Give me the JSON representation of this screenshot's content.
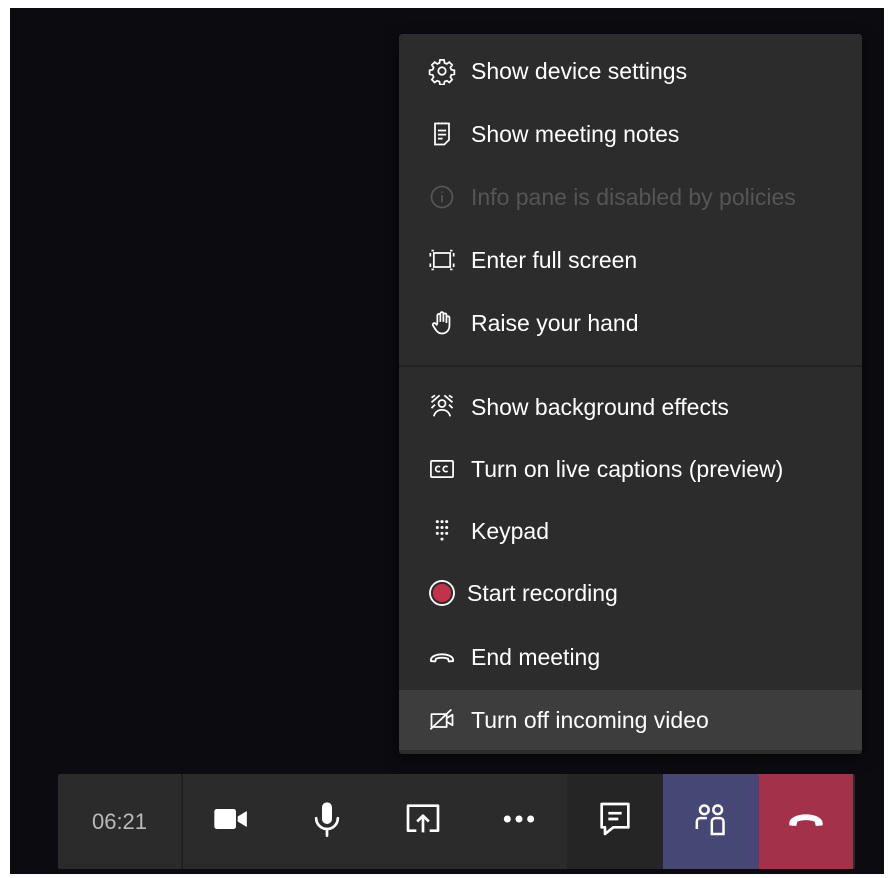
{
  "menu": {
    "items": [
      {
        "label": "Show device settings",
        "icon": "gear-icon"
      },
      {
        "label": "Show meeting notes",
        "icon": "notes-icon"
      },
      {
        "label": "Info pane is disabled by policies",
        "icon": "info-icon",
        "disabled": true
      },
      {
        "label": "Enter full screen",
        "icon": "fullscreen-icon"
      },
      {
        "label": "Raise your hand",
        "icon": "hand-icon"
      },
      {
        "label": "Show background effects",
        "icon": "background-effects-icon"
      },
      {
        "label": "Turn on live captions (preview)",
        "icon": "captions-icon"
      },
      {
        "label": "Keypad",
        "icon": "keypad-icon"
      },
      {
        "label": "Start recording",
        "icon": "record-icon"
      },
      {
        "label": "End meeting",
        "icon": "end-meeting-icon"
      },
      {
        "label": "Turn off incoming video",
        "icon": "video-off-icon",
        "highlighted": true
      }
    ]
  },
  "toolbar": {
    "timer": "06:21",
    "buttons": [
      "camera-icon",
      "microphone-icon",
      "share-screen-icon",
      "more-options-icon",
      "chat-icon",
      "participants-icon",
      "hang-up-icon"
    ]
  },
  "colors": {
    "background": "#0c0b10",
    "menu": "#2c2c2c",
    "toolbar": "#2b2b2b",
    "participants_active": "#464775",
    "hang_up": "#a4314a",
    "record": "#c4314b"
  }
}
